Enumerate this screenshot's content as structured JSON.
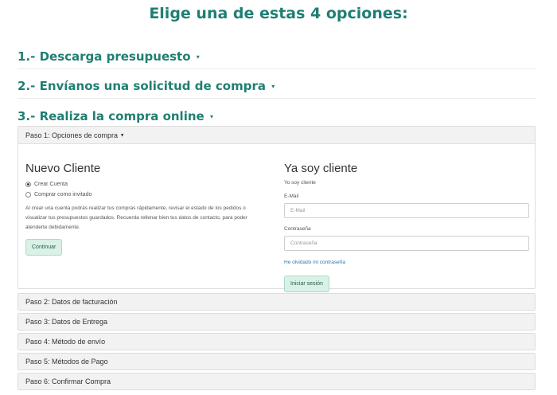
{
  "main_title": "Elige una de estas 4 opciones:",
  "options": {
    "opt1": "1.- Descarga presupuesto",
    "opt2": "2.- Envíanos una solicitud de compra",
    "opt3": "3.- Realiza la compra online"
  },
  "step1": {
    "header": "Paso 1: Opciones de compra",
    "new_client": {
      "title": "Nuevo Cliente",
      "radio_create": "Crear Cuenta",
      "radio_guest": "Comprar como invitado",
      "selected": "Crear Cuenta",
      "description": "Al crear una cuenta podrás realizar tus compras rápidamente, revisar el estado de los pedidos o visualizar tus presupuestos guardados. Recuerda rellenar bien tus datos de contacto, para poder atenderte debidamente.",
      "continue_label": "Continuar"
    },
    "existing_client": {
      "title": "Ya soy cliente",
      "subtitle": "Yo soy cliente",
      "email_label": "E-Mail",
      "email_placeholder": "E-Mail",
      "email_value": "",
      "password_label": "Contraseña",
      "password_placeholder": "Contraseña",
      "password_value": "",
      "forgot_link": "He olvidado mi contraseña",
      "login_label": "Iniciar sesión"
    }
  },
  "steps": {
    "step2": "Paso 2: Datos de facturación",
    "step3": "Paso 3: Datos de Entrega",
    "step4": "Paso 4: Método de envío",
    "step5": "Paso 5: Métodos de Pago",
    "step6": "Paso 6: Confirmar Compra"
  },
  "colors": {
    "heading": "#1f7f73",
    "button_bg": "#d9f1e6",
    "link": "#2a7ab0"
  },
  "icons": {
    "caret": "caret-down-icon"
  }
}
